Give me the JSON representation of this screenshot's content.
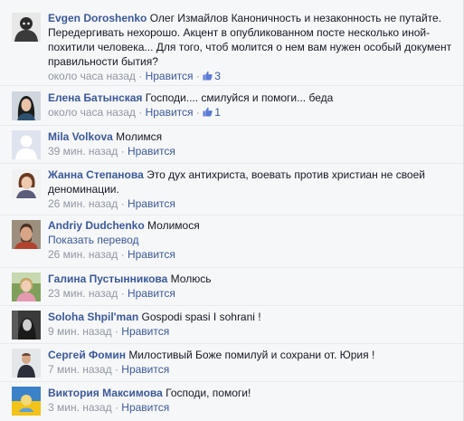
{
  "comments": [
    {
      "author": "Evgen Doroshenko",
      "text": "Олег Измайлов Каноничность и незаконность не путайте. Передергивать нехорошо. Акцент в опубликованном посте несколько иной- похитили человека... Для того, чтоб молится о нем вам нужен особый документ правильности бытия?",
      "time": "около часа назад",
      "like_label": "Нравится",
      "likes": "3",
      "avatar_icon": "user-photo-icon"
    },
    {
      "author": "Елена Батынская",
      "text": "Господи.... смилуйся и помоги... беда",
      "time": "около часа назад",
      "like_label": "Нравится",
      "likes": "1",
      "avatar_icon": "user-photo-icon"
    },
    {
      "author": "Mila Volkova",
      "text": "Молимся",
      "time": "39 мин. назад",
      "like_label": "Нравится",
      "avatar_icon": "default-avatar-icon"
    },
    {
      "author": "Жанна Степанова",
      "text": "Это дух антихриста, воевать против христиан не своей деноминации.",
      "time": "26 мин. назад",
      "like_label": "Нравится",
      "avatar_icon": "user-photo-icon"
    },
    {
      "author": "Andriy Dudchenko",
      "text": "Молимося",
      "translate_label": "Показать перевод",
      "time": "26 мин. назад",
      "like_label": "Нравится",
      "avatar_icon": "user-photo-icon"
    },
    {
      "author": "Галина Пустынникова",
      "text": "Молюсь",
      "time": "23 мин. назад",
      "like_label": "Нравится",
      "avatar_icon": "user-photo-icon"
    },
    {
      "author": "Soloha Shpil'man",
      "text": "Gospodi spasi I sohrani !",
      "time": "9 мин. назад",
      "like_label": "Нравится",
      "avatar_icon": "user-photo-icon"
    },
    {
      "author": "Сергей Фомин",
      "text": "Милостивый Боже помилуй и сохрани от. Юрия !",
      "time": "7 мин. назад",
      "like_label": "Нравится",
      "avatar_icon": "user-photo-icon"
    },
    {
      "author": "Виктория Максимова",
      "text": "Господи, помоги!",
      "time": "3 мин. назад",
      "like_label": "Нравится",
      "avatar_icon": "user-photo-icon"
    }
  ],
  "separator": "·",
  "colors": {
    "link": "#3b5998",
    "meta": "#9197a3",
    "background": "#f6f7f8",
    "border": "#e9eaed"
  }
}
